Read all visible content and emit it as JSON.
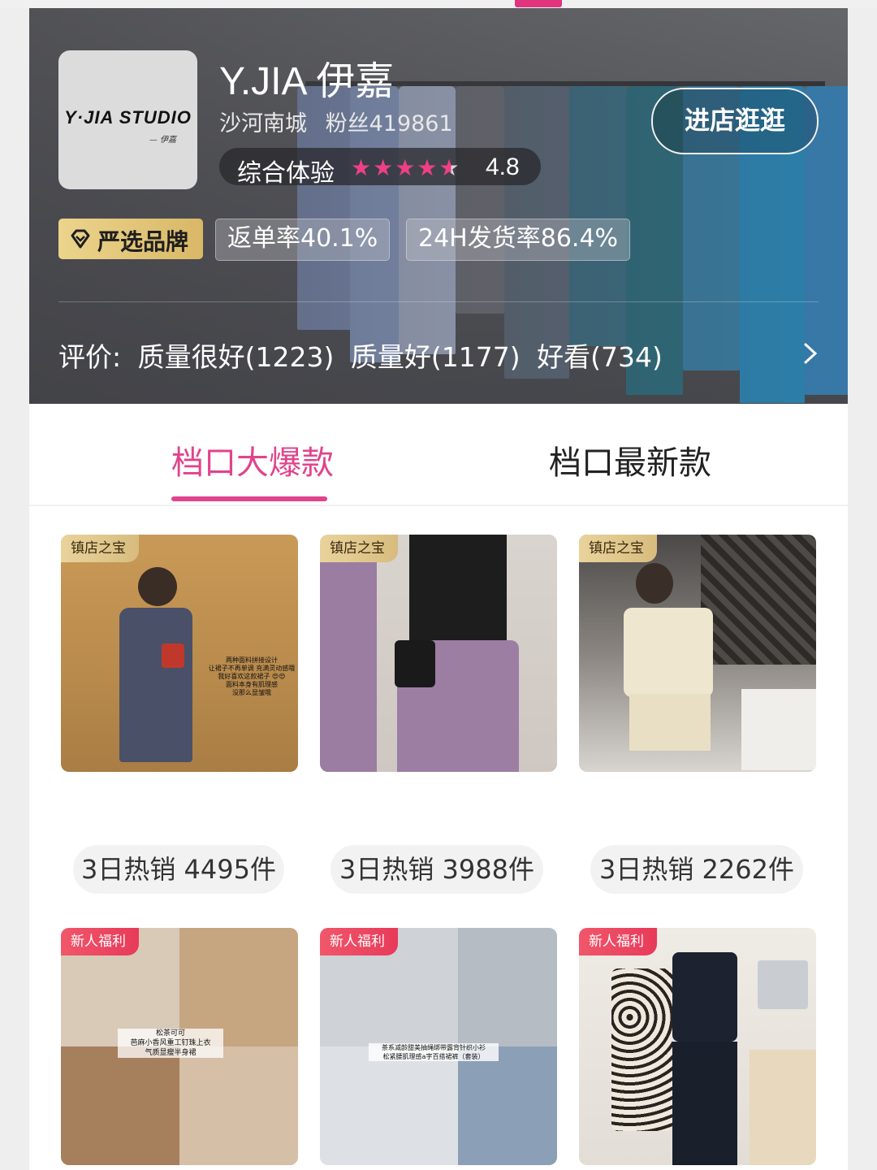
{
  "shop": {
    "logo_text": "Y·JIA  STUDIO",
    "logo_subtext": "— 伊嘉",
    "name": "Y.JIA 伊嘉",
    "location": "沙河南城",
    "fans": "粉丝419861",
    "rating_label": "综合体验",
    "rating_stars": 4.8,
    "rating_score": "4.8",
    "enter_button": "进店逛逛"
  },
  "badges": {
    "brand": "严选品牌",
    "return_rate": "返单率40.1%",
    "ship_rate": "24H发货率86.4%"
  },
  "reviews": {
    "label": "评价:",
    "items": [
      "质量很好(1223)",
      "质量好(1177)",
      "好看(734)"
    ]
  },
  "tabs": [
    {
      "label": "档口大爆款",
      "active": true
    },
    {
      "label": "档口最新款",
      "active": false
    }
  ],
  "products_row1": [
    {
      "tag": "镇店之宝",
      "caption_lines": [
        "两种面料拼接设计",
        "让裙子不再单调 充满灵动感哦",
        "我好喜欢这款裙子 😍😍",
        "面料本身有肌理感",
        "没那么显皱哦"
      ],
      "sales": "3日热销 4495件"
    },
    {
      "tag": "镇店之宝",
      "sales": "3日热销 3988件"
    },
    {
      "tag": "镇店之宝",
      "sales": "3日热销 2262件"
    }
  ],
  "products_row2": [
    {
      "tag": "新人福利",
      "caption_lines": [
        "松茶可可",
        "芭麻小香风重工钉珠上衣",
        "气质显瘦半身裙"
      ]
    },
    {
      "tag": "新人福利",
      "caption_lines": [
        "茶系减龄甜美抽绳绑带露背针织小衫",
        "松紧腰肌理感a字百搭裙裤（套装）"
      ]
    },
    {
      "tag": "新人福利"
    }
  ],
  "colors": {
    "accent": "#e0448c",
    "star": "#ef3f86",
    "brand_gold": "#e0c77e"
  }
}
